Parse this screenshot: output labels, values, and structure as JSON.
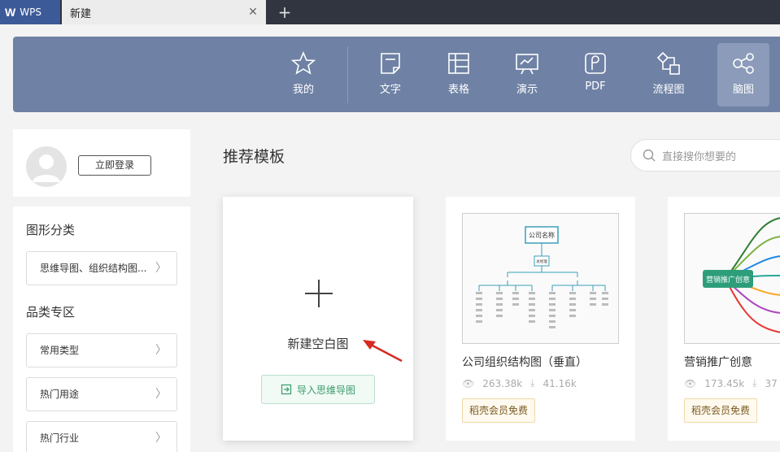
{
  "tabbar": {
    "app_label": "WPS",
    "doc_tab": "新建",
    "close_glyph": "✕",
    "add_glyph": "+"
  },
  "toolbar": {
    "items": [
      {
        "label": "我的",
        "icon": "star-icon"
      },
      {
        "label": "文字",
        "icon": "document-icon"
      },
      {
        "label": "表格",
        "icon": "table-icon"
      },
      {
        "label": "演示",
        "icon": "presentation-icon"
      },
      {
        "label": "PDF",
        "icon": "pdf-icon"
      },
      {
        "label": "流程图",
        "icon": "flowchart-icon"
      },
      {
        "label": "脑图",
        "icon": "mindmap-icon"
      }
    ],
    "active": "脑图"
  },
  "user": {
    "login_label": "立即登录"
  },
  "sidebar": {
    "section1_title": "图形分类",
    "section1_item": "思维导图、组织结构图...",
    "section2_title": "品类专区",
    "section2_items": [
      "常用类型",
      "热门用途",
      "热门行业"
    ]
  },
  "main": {
    "title": "推荐模板",
    "search_placeholder": "直接搜你想要的"
  },
  "new_card": {
    "label": "新建空白图",
    "import_label": "导入思维导图"
  },
  "templates": [
    {
      "name": "公司组织结构图（垂直）",
      "views": "263.38k",
      "downloads": "41.16k",
      "badge": "稻壳会员免费",
      "thumb_title": "公司名称",
      "thumb_sub": "总经理"
    },
    {
      "name": "营销推广创意",
      "views": "173.45k",
      "downloads": "37",
      "badge": "稻壳会员免费",
      "thumb_title": "营销推广创意"
    }
  ],
  "colors": {
    "toolbar_bg": "#6f82a5",
    "tabbar_bg": "#30353f",
    "accent_green": "#3b9b6a",
    "arrow_red": "#d62a22"
  }
}
